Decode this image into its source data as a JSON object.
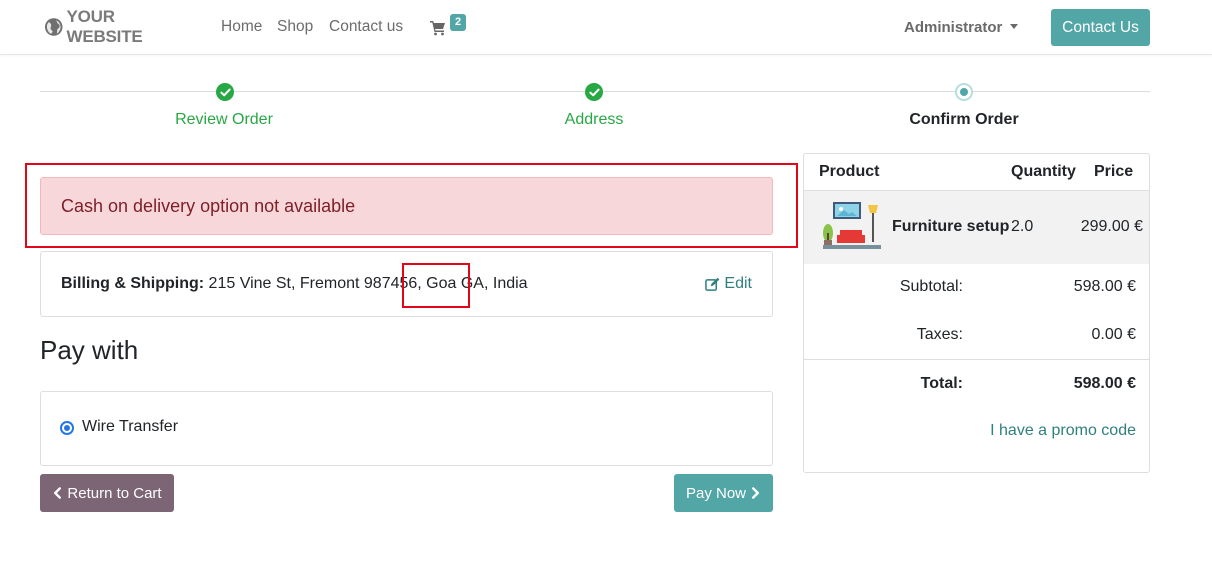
{
  "navbar": {
    "logo_text": "YOUR WEBSITE",
    "links": [
      "Home",
      "Shop",
      "Contact us"
    ],
    "cart_count": "2",
    "user": "Administrator",
    "contact_button": "Contact Us"
  },
  "wizard": {
    "steps": [
      {
        "label": "Review Order",
        "state": "done"
      },
      {
        "label": "Address",
        "state": "done"
      },
      {
        "label": "Confirm Order",
        "state": "current"
      }
    ]
  },
  "alert": {
    "message": "Cash on delivery option not available"
  },
  "address": {
    "heading": "Billing & Shipping:",
    "value": "215 Vine St, Fremont 987456, Goa GA, India",
    "value_part1": "215 Vine St, Fremont 987456",
    "value_part2": "Goa GA",
    "value_part3": "India",
    "edit_label": "Edit"
  },
  "payment": {
    "title": "Pay with",
    "methods": [
      {
        "label": "Wire Transfer",
        "selected": true
      }
    ],
    "return_button": "Return to Cart",
    "pay_button": "Pay Now"
  },
  "summary": {
    "headers": {
      "product": "Product",
      "quantity": "Quantity",
      "price": "Price"
    },
    "items": [
      {
        "name": "Furniture setup",
        "quantity": "2.0",
        "price": "299.00 €"
      }
    ],
    "subtotal_label": "Subtotal:",
    "subtotal": "598.00 €",
    "taxes_label": "Taxes:",
    "taxes": "0.00 €",
    "total_label": "Total:",
    "total": "598.00 €",
    "promo_link": "I have a promo code"
  },
  "colors": {
    "primary": "#52a6a6",
    "success": "#28a745",
    "alert_bg": "#f8d7da",
    "alert_text": "#7d1f27",
    "secondary_button": "#7c6575",
    "annotation_red": "#e3061b"
  }
}
